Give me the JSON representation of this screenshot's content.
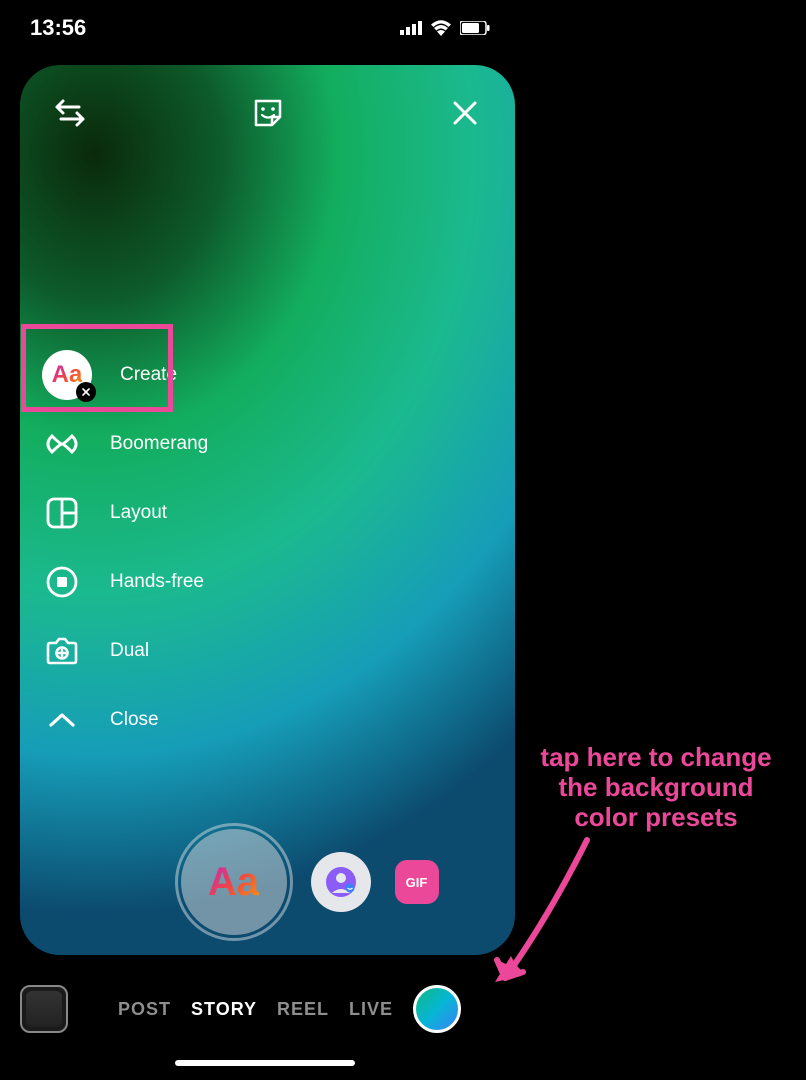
{
  "status": {
    "time": "13:56"
  },
  "menu": {
    "create": "Create",
    "boomerang": "Boomerang",
    "layout": "Layout",
    "handsfree": "Hands-free",
    "dual": "Dual",
    "close": "Close"
  },
  "main_button": {
    "aa": "Aa",
    "gif": "GIF"
  },
  "tabs": {
    "post": "POST",
    "story": "STORY",
    "reel": "REEL",
    "live": "LIVE"
  },
  "annotation": {
    "text": "tap here to change the background color presets"
  },
  "colors": {
    "highlight": "#ec4899"
  }
}
